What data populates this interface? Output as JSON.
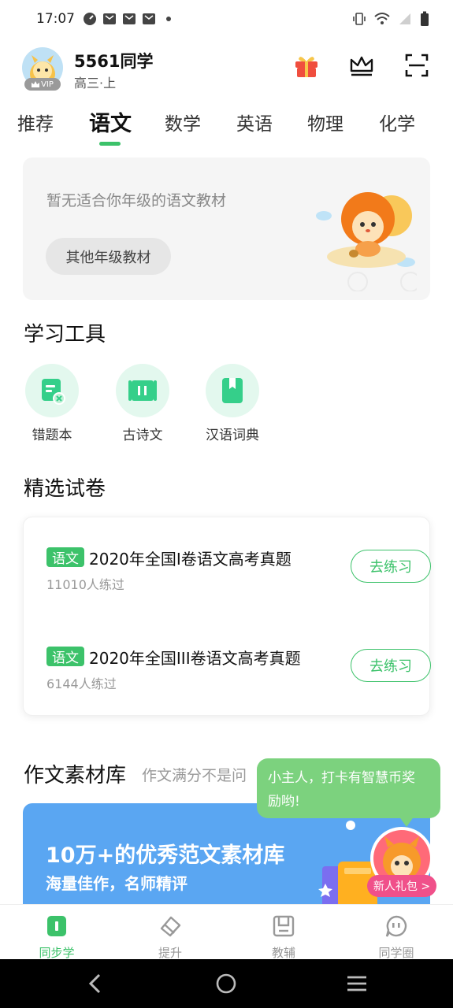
{
  "status_bar": {
    "time": "17:07"
  },
  "profile": {
    "username": "5561同学",
    "grade": "高三·上",
    "vip_label": "VIP"
  },
  "tabs": [
    "推荐",
    "语文",
    "数学",
    "英语",
    "物理",
    "化学"
  ],
  "active_tab": "语文",
  "textbook": {
    "message": "暂无适合你年级的语文教材",
    "button_label": "其他年级教材"
  },
  "tools": {
    "title": "学习工具",
    "items": [
      {
        "label": "错题本",
        "icon": "wrong-notebook-icon"
      },
      {
        "label": "古诗文",
        "icon": "poetry-scroll-icon"
      },
      {
        "label": "汉语词典",
        "icon": "dictionary-icon"
      }
    ]
  },
  "papers": {
    "title": "精选试卷",
    "items": [
      {
        "subject": "语文",
        "title": "2020年全国I卷语文高考真题",
        "count": "11010人练过",
        "action": "去练习"
      },
      {
        "subject": "语文",
        "title": "2020年全国III卷语文高考真题",
        "count": "6144人练过",
        "action": "去练习"
      }
    ]
  },
  "essay": {
    "title": "作文素材库",
    "subtitle": "作文满分不是问",
    "banner_title": "10万+的优秀范文素材库",
    "banner_subtitle": "海量佳作，名师精评"
  },
  "bubble": {
    "line1": "小主人，打卡有智慧币奖",
    "line2": "励哟!"
  },
  "gift_label": "新人礼包 >",
  "bottom_nav": [
    {
      "label": "同步学",
      "active": true
    },
    {
      "label": "提升",
      "active": false
    },
    {
      "label": "教辅",
      "active": false
    },
    {
      "label": "同学圈",
      "active": false
    }
  ],
  "colors": {
    "accent": "#3cc26a",
    "banner": "#5aa6f2",
    "bubble": "#7cd27e"
  }
}
